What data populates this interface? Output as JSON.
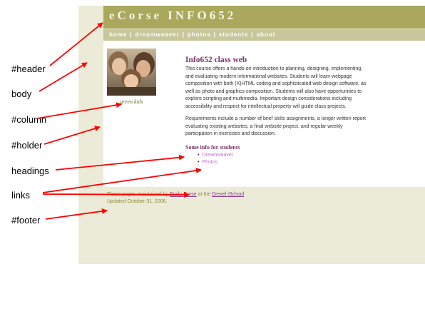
{
  "site": {
    "title": "eCorse INFO652",
    "nav": [
      "home",
      "dreamweaver",
      "photos",
      "students",
      "about"
    ],
    "nav_separator": "|"
  },
  "sidebar": {
    "photo_caption": "green kids"
  },
  "main": {
    "heading": "Info652 class web",
    "paragraph1": [
      "This course offers a hands-on introduction to planning, designing, implementing,",
      "and evaluating modern informational websites.  Students will learn webpage",
      "composition with both (X)HTML coding and sophisticated web design software, as",
      "well as photo and graphics composition.  Students will also have opportunities to",
      "explore scripting and multimedia.  Important design considerations including",
      "accessibility and respect for intellectual property will guide class projects."
    ],
    "paragraph2": [
      "Requirements include a number of brief skills assignments, a longer written report",
      "evaluating existing websites, a final website project, and regular weekly",
      "participation in exercises and discussion."
    ],
    "subheading": "Some info for students",
    "links": [
      "Dreamweaver",
      "Photos"
    ]
  },
  "footer": {
    "line1_prefix": "These pages maintained by",
    "line1_name": "Emily Corse",
    "line1_middle": "at the",
    "line1_org": "Drexel iSchool",
    "line2": "Updated October 31, 2006."
  },
  "callouts": [
    "#header",
    "body",
    "#column",
    "#holder",
    "headings",
    "links",
    "#footer"
  ],
  "colors": {
    "header_bg": "#a9a85c",
    "nav_bg": "#c8c79c",
    "page_bg": "#ebebd7",
    "heading": "#7a3068",
    "link": "#cc66cc",
    "arrow": "#ff0000"
  }
}
